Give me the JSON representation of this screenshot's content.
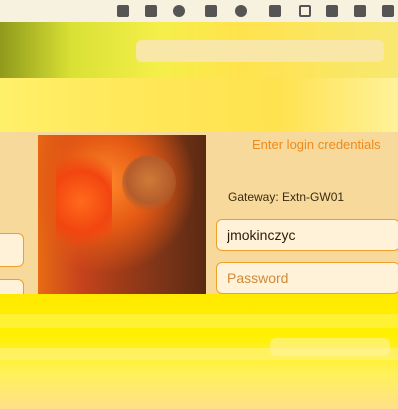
{
  "login": {
    "title": "Enter login credentials",
    "gateway_label": "Gateway: Extn-GW01",
    "username_value": "jmokinczyc",
    "password_placeholder": "Password"
  }
}
